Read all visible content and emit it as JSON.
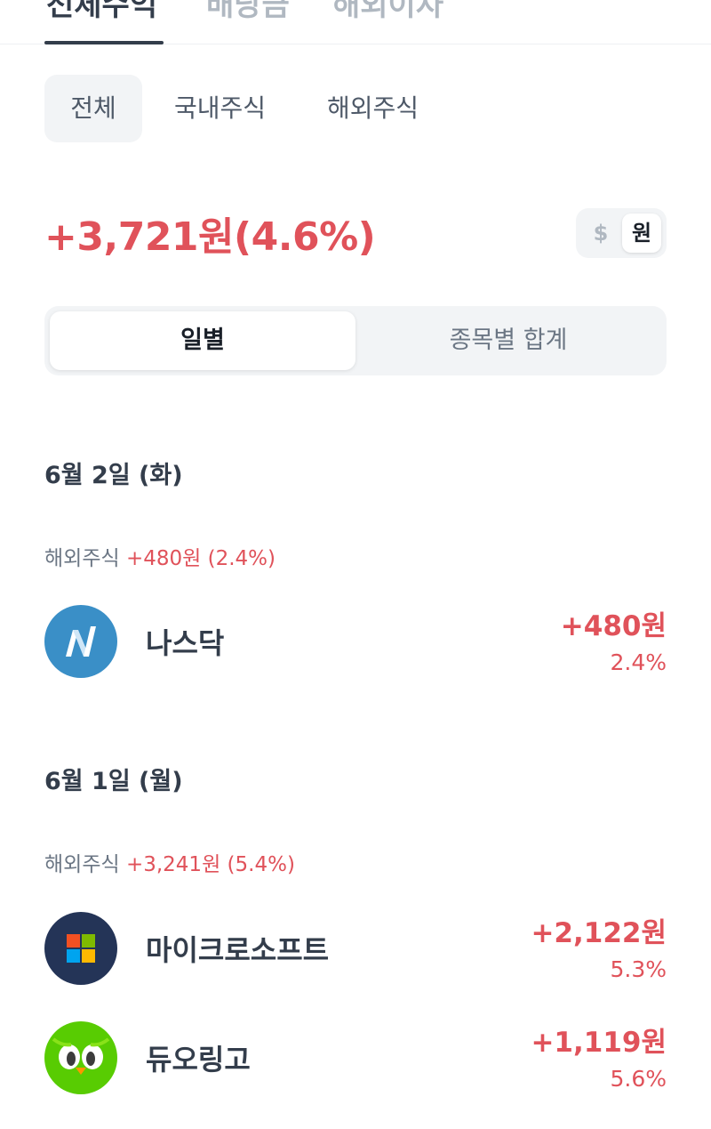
{
  "top_tabs": [
    {
      "label": "전체수익"
    },
    {
      "label": "배당금"
    },
    {
      "label": "해외이자"
    }
  ],
  "filters": [
    {
      "label": "전체",
      "active": true
    },
    {
      "label": "국내주식",
      "active": false
    },
    {
      "label": "해외주식",
      "active": false
    }
  ],
  "total_profit": "+3,721원(4.6%)",
  "currency_toggle": {
    "usd": "$",
    "krw": "원",
    "selected": "krw"
  },
  "segments": [
    {
      "label": "일별",
      "active": true
    },
    {
      "label": "종목별 합계",
      "active": false
    }
  ],
  "days": [
    {
      "date": "6월 2일 (화)",
      "group": {
        "label": "해외주식",
        "change": "+480원 (2.4%)"
      },
      "stocks": [
        {
          "name": "나스닥",
          "amount": "+480원",
          "percent": "2.4%",
          "logo": "nasdaq-logo",
          "logo_color": "#3a8fc7"
        }
      ]
    },
    {
      "date": "6월 1일 (월)",
      "group": {
        "label": "해외주식",
        "change": "+3,241원 (5.4%)"
      },
      "stocks": [
        {
          "name": "마이크로소프트",
          "amount": "+2,122원",
          "percent": "5.3%",
          "logo": "microsoft-logo",
          "logo_color": "#243457"
        },
        {
          "name": "듀오링고",
          "amount": "+1,119원",
          "percent": "5.6%",
          "logo": "duolingo-logo",
          "logo_color": "#58cc02"
        }
      ]
    }
  ],
  "colors": {
    "profit": "#e0525a",
    "text_primary": "#333d4b",
    "text_secondary": "#6b7684",
    "surface": "#f2f4f6"
  }
}
